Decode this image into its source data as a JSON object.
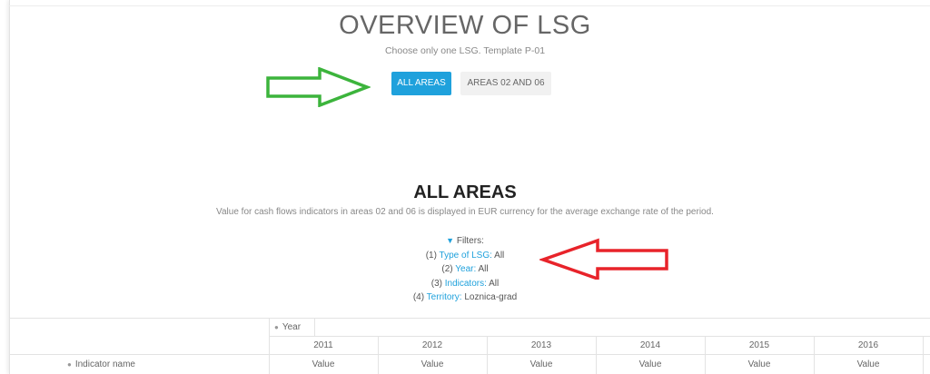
{
  "header": {
    "title": "OVERVIEW OF LSG",
    "subtitle": "Choose only one LSG. Template P-01"
  },
  "tabs": [
    {
      "label": "ALL AREAS",
      "active": true
    },
    {
      "label": "AREAS 02 AND 06",
      "active": false
    }
  ],
  "section": {
    "title": "ALL AREAS",
    "description": "Value for cash flows indicators in areas 02 and 06 is displayed in EUR currency for the average exchange rate of the period."
  },
  "filters": {
    "heading": "Filters:",
    "items": [
      {
        "prefix": "(1)",
        "label": "Type of LSG:",
        "value": "All"
      },
      {
        "prefix": "(2)",
        "label": "Year:",
        "value": "All"
      },
      {
        "prefix": "(3)",
        "label": "Indicators:",
        "value": "All"
      },
      {
        "prefix": "(4)",
        "label": "Territory:",
        "value": "Loznica-grad"
      }
    ]
  },
  "table": {
    "year_header": "Year",
    "row_header": "Indicator name",
    "years": [
      "2011",
      "2012",
      "2013",
      "2014",
      "2015",
      "2016"
    ],
    "values": [
      "Value",
      "Value",
      "Value",
      "Value",
      "Value",
      "Value"
    ]
  },
  "colors": {
    "accent": "#1fa1dc",
    "green_arrow": "#3cb43c",
    "red_arrow": "#e8232a"
  },
  "icons": [
    "arrow-right-green-icon",
    "arrow-left-red-icon",
    "funnel-icon"
  ]
}
